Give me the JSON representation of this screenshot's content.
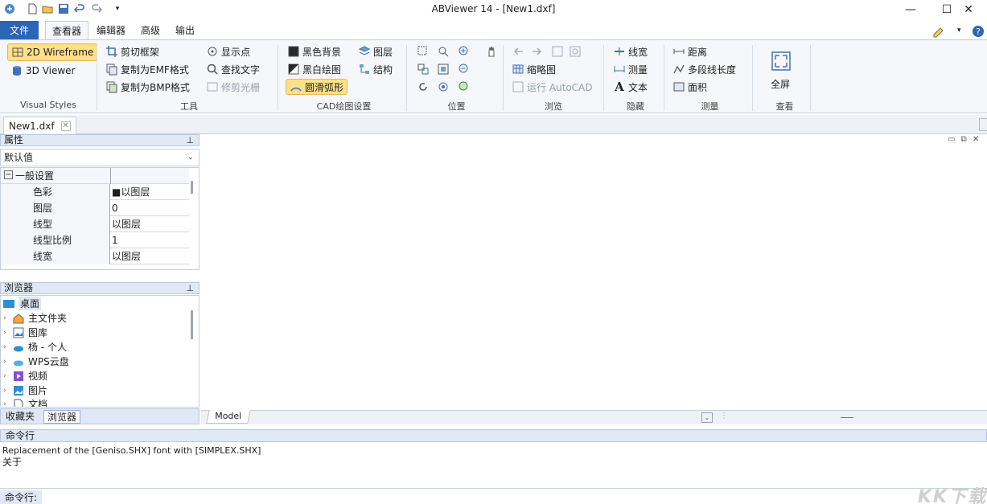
{
  "app": {
    "title": "ABViewer 14 - [New1.dxf]"
  },
  "quick_access": [
    "app-icon",
    "new-icon",
    "open-icon",
    "save-icon",
    "undo-icon",
    "redo-icon",
    "customize-icon"
  ],
  "window_controls": {
    "minimize": "—",
    "maximize": "☐",
    "close": "✕"
  },
  "tabs": [
    {
      "label": "文件"
    },
    {
      "label": "查看器"
    },
    {
      "label": "编辑器"
    },
    {
      "label": "高级"
    },
    {
      "label": "输出"
    }
  ],
  "ribbon": {
    "visual_styles": {
      "label": "Visual Styles",
      "wireframe_2d": "2D Wireframe",
      "viewer_3d": "3D Viewer"
    },
    "tools": {
      "label": "工具",
      "clip_frame": "剪切框架",
      "copy_emf": "复制为EMF格式",
      "copy_bmp": "复制为BMP格式",
      "show_points": "显示点",
      "find_text": "查找文字",
      "trim_raster": "修剪光栅"
    },
    "cad_settings": {
      "label": "CAD绘图设置",
      "black_bg": "黑色背景",
      "bw_drawing": "黑白绘图",
      "smooth_arcs": "圆滑弧形",
      "layers": "图层",
      "structure": "结构"
    },
    "position": {
      "label": "位置"
    },
    "browse": {
      "label": "浏览",
      "thumbnails": "缩略图",
      "run_autocad": "运行 AutoCAD"
    },
    "hide": {
      "label": "隐藏",
      "linewidth": "线宽",
      "measure": "测量",
      "text": "文本"
    },
    "measure": {
      "label": "测量",
      "distance": "距离",
      "polyline_length": "多段线长度",
      "area": "面积"
    },
    "view": {
      "label": "查看",
      "fullscreen": "全屏"
    }
  },
  "document_tab": {
    "label": "New1.dxf"
  },
  "properties_panel": {
    "title": "属性",
    "selector": "默认值",
    "group": "一般设置",
    "rows": [
      {
        "name": "色彩",
        "value": "■以图层"
      },
      {
        "name": "图层",
        "value": "0"
      },
      {
        "name": "线型",
        "value": "以图层"
      },
      {
        "name": "线型比例",
        "value": "1"
      },
      {
        "name": "线宽",
        "value": "以图层"
      }
    ]
  },
  "browser_panel": {
    "title": "浏览器",
    "items": [
      {
        "label": "桌面"
      },
      {
        "label": "主文件夹"
      },
      {
        "label": "图库"
      },
      {
        "label": "杨 - 个人"
      },
      {
        "label": "WPS云盘"
      },
      {
        "label": "视频"
      },
      {
        "label": "图片"
      },
      {
        "label": "文档"
      }
    ],
    "bottom_tabs": [
      "收藏夹",
      "浏览器"
    ]
  },
  "model_tab": {
    "label": "Model"
  },
  "command": {
    "header": "命令行",
    "log": [
      "Replacement of the [Geniso.SHX] font with [SIMPLEX.SHX]",
      "关于"
    ],
    "prompt_label": "命令行:"
  },
  "watermark": "KK下载",
  "colors": {
    "file_tab": "#2b66b6",
    "highlight": "#ffe08a",
    "panel_header": "#dfe8f4",
    "ribbon_bg": "#f5f7fa"
  }
}
